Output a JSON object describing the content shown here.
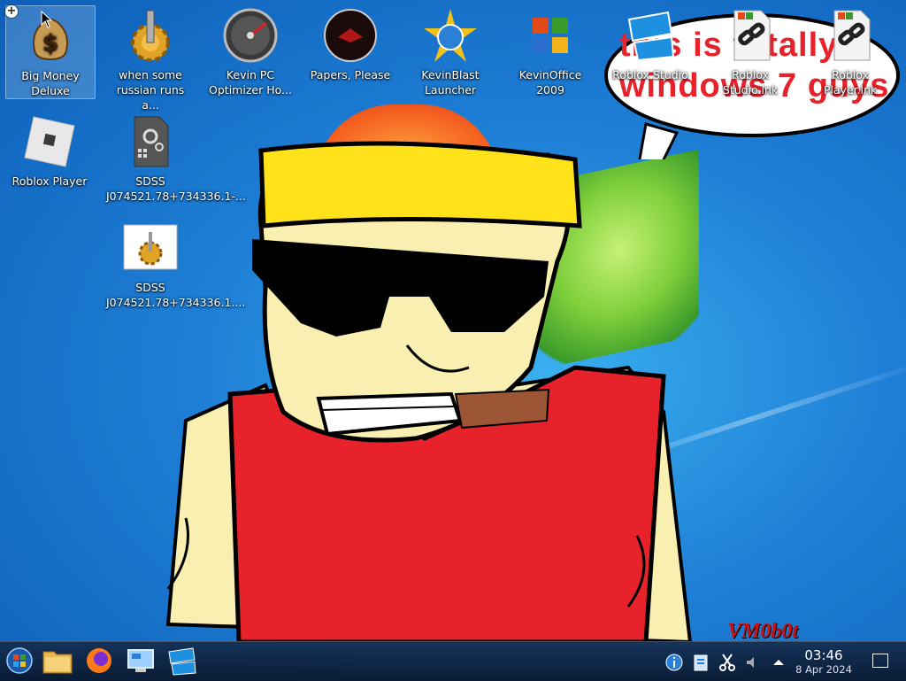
{
  "desktop": {
    "icons": [
      {
        "label": "Big Money Deluxe",
        "icon": "money-bag-icon"
      },
      {
        "label": "when some russian runs a...",
        "icon": "gear-icon"
      },
      {
        "label": "Kevin PC Optimizer Ho...",
        "icon": "speedometer-icon"
      },
      {
        "label": "Papers, Please",
        "icon": "papers-please-icon"
      },
      {
        "label": "KevinBlast Launcher",
        "icon": "globe-star-icon"
      },
      {
        "label": "KevinOffice 2009",
        "icon": "office-icon"
      },
      {
        "label": "Roblox Studio",
        "icon": "roblox-studio-icon"
      },
      {
        "label": "Roblox Studio.lnk",
        "icon": "shortcut-link-icon"
      },
      {
        "label": "Roblox Player.lnk",
        "icon": "shortcut-link-icon"
      },
      {
        "label": "Roblox Player",
        "icon": "roblox-player-icon"
      },
      {
        "label": "SDSS J074521.78+734336.1-...",
        "icon": "settings-file-icon"
      },
      {
        "label": "SDSS J074521.78+734336.1....",
        "icon": "gear-thumbnail-icon"
      }
    ],
    "bubble_text": "this is totally windows 7 guys",
    "watermark": "VM0b0t"
  },
  "taskbar": {
    "apps": [
      "start-orb-icon",
      "file-explorer-icon",
      "firefox-icon",
      "control-panel-icon",
      "roblox-studio-icon"
    ],
    "tray": [
      "info-icon",
      "clipboard-icon",
      "scissors-icon",
      "volume-icon",
      "tray-expand-icon"
    ],
    "time": "03:46",
    "date": "8 Apr 2024"
  },
  "colors": {
    "accent": "#1e7fd6",
    "bubble_text": "#e8222a",
    "taskbar": "#0e2244"
  }
}
